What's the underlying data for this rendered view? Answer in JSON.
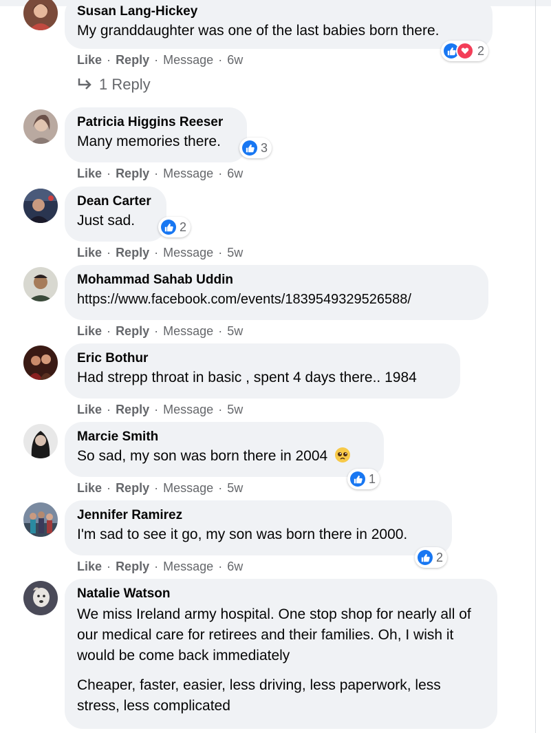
{
  "actions": {
    "like": "Like",
    "reply": "Reply",
    "message": "Message",
    "sep": "·"
  },
  "colors": {
    "like_blue": "#1877f2",
    "love_red": "#f33e58",
    "bubble_bg": "#f0f2f5",
    "meta_gray": "#65676b"
  },
  "comments": [
    {
      "name": "Susan Lang-Hickey",
      "text": "My granddaughter was one of the last babies born there.",
      "time": "6w",
      "reactions": {
        "types": [
          "like-icon",
          "love-icon"
        ],
        "count": "2"
      },
      "replies_label": "1 Reply"
    },
    {
      "name": "Patricia Higgins Reeser",
      "text": "Many memories there.",
      "time": "6w",
      "reactions": {
        "types": [
          "like-icon"
        ],
        "count": "3"
      }
    },
    {
      "name": "Dean Carter",
      "text": "Just sad.",
      "time": "5w",
      "reactions": {
        "types": [
          "like-icon"
        ],
        "count": "2"
      }
    },
    {
      "name": "Mohammad Sahab Uddin",
      "text": "https://www.facebook.com/events/1839549329526588/",
      "time": "5w"
    },
    {
      "name": "Eric Bothur",
      "text": "Had strepp throat in basic , spent 4 days there.. 1984",
      "time": "5w"
    },
    {
      "name": "Marcie Smith",
      "text": "So sad, my son was born there in 2004",
      "emoji": "pleading-face-emoji",
      "time": "5w",
      "reactions": {
        "types": [
          "like-icon"
        ],
        "count": "1"
      }
    },
    {
      "name": "Jennifer Ramirez",
      "text": "I'm sad to see it go, my son was born there in 2000.",
      "time": "6w",
      "reactions": {
        "types": [
          "like-icon"
        ],
        "count": "2"
      }
    },
    {
      "name": "Natalie Watson",
      "text": "We miss Ireland army hospital. One stop shop for nearly all of our medical care for retirees and their families. Oh, I wish it would be come back immediately",
      "text2": "Cheaper, faster, easier, less driving, less paperwork, less stress, less complicated"
    }
  ]
}
